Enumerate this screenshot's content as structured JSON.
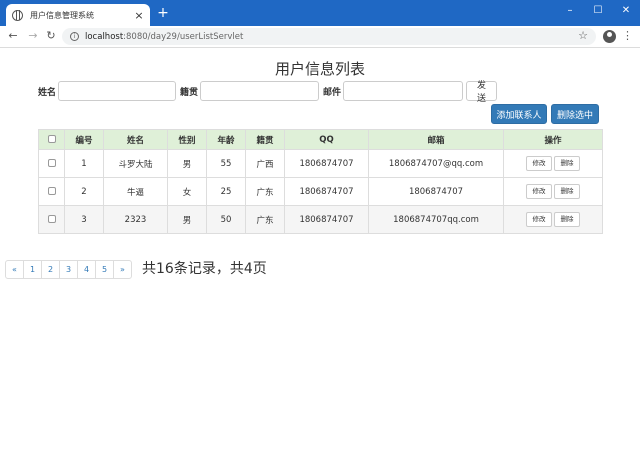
{
  "browser": {
    "tab_title": "用户信息管理系统",
    "url_host": "localhost",
    "url_rest": ":8080/day29/userListServlet",
    "controls": {
      "minimize": "–",
      "maximize": "☐",
      "close": "✕",
      "new_tab": "+",
      "tab_close": "×",
      "back": "←",
      "forward": "→",
      "reload": "↻",
      "star": "☆",
      "menu": "⋮",
      "info": "i"
    }
  },
  "page": {
    "title": "用户信息列表",
    "search": {
      "name_label": "姓名",
      "origin_label": "籍贯",
      "email_label": "邮件",
      "name_value": "",
      "origin_value": "",
      "email_value": "",
      "submit_label": "发送"
    },
    "actions": {
      "add_label": "添加联系人",
      "delete_selected_label": "删除选中"
    },
    "table": {
      "headers": [
        "",
        "编号",
        "姓名",
        "性别",
        "年龄",
        "籍贯",
        "QQ",
        "邮箱",
        "操作"
      ],
      "rows": [
        {
          "id": "1",
          "name": "斗罗大陆",
          "gender": "男",
          "age": "55",
          "origin": "广西",
          "qq": "1806874707",
          "email": "1806874707@qq.com",
          "edit": "修改",
          "delete": "删除"
        },
        {
          "id": "2",
          "name": "牛逼",
          "gender": "女",
          "age": "25",
          "origin": "广东",
          "qq": "1806874707",
          "email": "1806874707",
          "edit": "修改",
          "delete": "删除"
        },
        {
          "id": "3",
          "name": "2323",
          "gender": "男",
          "age": "50",
          "origin": "广东",
          "qq": "1806874707",
          "email": "1806874707qq.com",
          "edit": "修改",
          "delete": "删除"
        }
      ]
    },
    "pagination": {
      "prev": "«",
      "pages": [
        "1",
        "2",
        "3",
        "4",
        "5"
      ],
      "next": "»",
      "summary": "共16条记录，共4页"
    }
  },
  "colors": {
    "titlebar": "#1f68c4",
    "primary": "#337ab7",
    "table_header": "#dff0d8"
  }
}
